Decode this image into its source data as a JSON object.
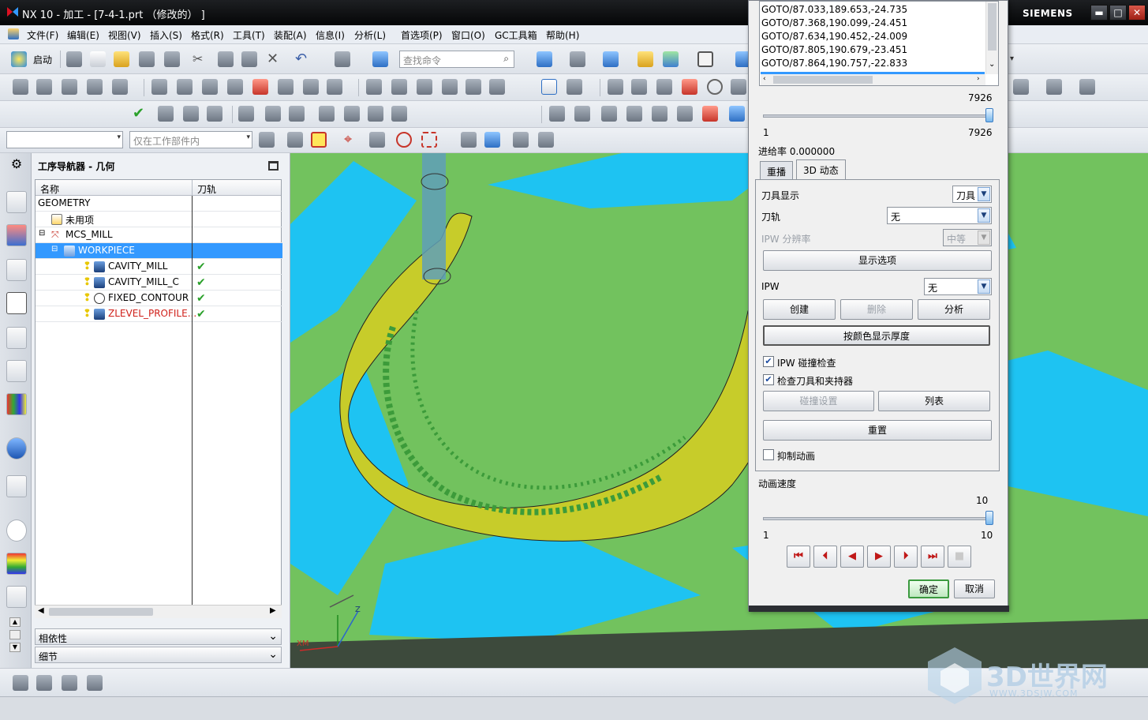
{
  "window": {
    "title": "NX 10 - 加工 - [7-4-1.prt （修改的） ]",
    "brand": "SIEMENS",
    "minimize": "▬",
    "maximize": "□",
    "close": "✕"
  },
  "menu": [
    "文件(F)",
    "编辑(E)",
    "视图(V)",
    "插入(S)",
    "格式(R)",
    "工具(T)",
    "装配(A)",
    "信息(I)",
    "分析(L)",
    "首选项(P)",
    "窗口(O)",
    "GC工具箱",
    "帮助(H)"
  ],
  "toolbar": {
    "start_label": "启动",
    "search_placeholder": "查找命令",
    "filter_placeholder": "仅在工作部件内"
  },
  "navigator": {
    "title": "工序导航器 - 几何",
    "col_name": "名称",
    "col_path": "刀轨",
    "rows": [
      {
        "name": "GEOMETRY",
        "check": ""
      },
      {
        "name": "未用项",
        "check": ""
      },
      {
        "name": "MCS_MILL",
        "check": ""
      },
      {
        "name": "WORKPIECE",
        "check": ""
      },
      {
        "name": "CAVITY_MILL",
        "check": "✔"
      },
      {
        "name": "CAVITY_MILL_C",
        "check": "✔"
      },
      {
        "name": "FIXED_CONTOUR",
        "check": "✔"
      },
      {
        "name": "ZLEVEL_PROFILE...",
        "check": "✔"
      }
    ],
    "panel_dep": "相依性",
    "panel_detail": "细节"
  },
  "dialog": {
    "gotos": [
      "GOTO/87.033,189.653,-24.735",
      "GOTO/87.368,190.099,-24.451",
      "GOTO/87.634,190.452,-24.009",
      "GOTO/87.805,190.679,-23.451",
      "GOTO/87.864,190.757,-22.833"
    ],
    "slider_top_value": "7926",
    "slider_min": "1",
    "slider_max": "7926",
    "feed_rate": "进给率 0.000000",
    "tab_replay": "重播",
    "tab_3d": "3D 动态",
    "tool_display_label": "刀具显示",
    "tool_display_value": "刀具",
    "toolpath_label": "刀轨",
    "toolpath_value": "无",
    "ipw_res_label": "IPW 分辨率",
    "ipw_res_value": "中等",
    "display_options": "显示选项",
    "ipw_label": "IPW",
    "ipw_value": "无",
    "create": "创建",
    "delete": "删除",
    "analyze": "分析",
    "color_thickness": "按颜色显示厚度",
    "ipw_collision": "IPW 碰撞检查",
    "check_tool_holder": "检查刀具和夹持器",
    "collision_settings": "碰撞设置",
    "list": "列表",
    "reset": "重置",
    "suppress_anim": "抑制动画",
    "anim_speed": "动画速度",
    "speed_value": "10",
    "speed_min": "1",
    "speed_max": "10",
    "ok": "确定",
    "cancel": "取消"
  },
  "viewport": {
    "axis_z": "Z",
    "axis_xm": "XM"
  },
  "watermark": {
    "text": "3D世界网",
    "url": "WWW.3DSJW.COM"
  }
}
